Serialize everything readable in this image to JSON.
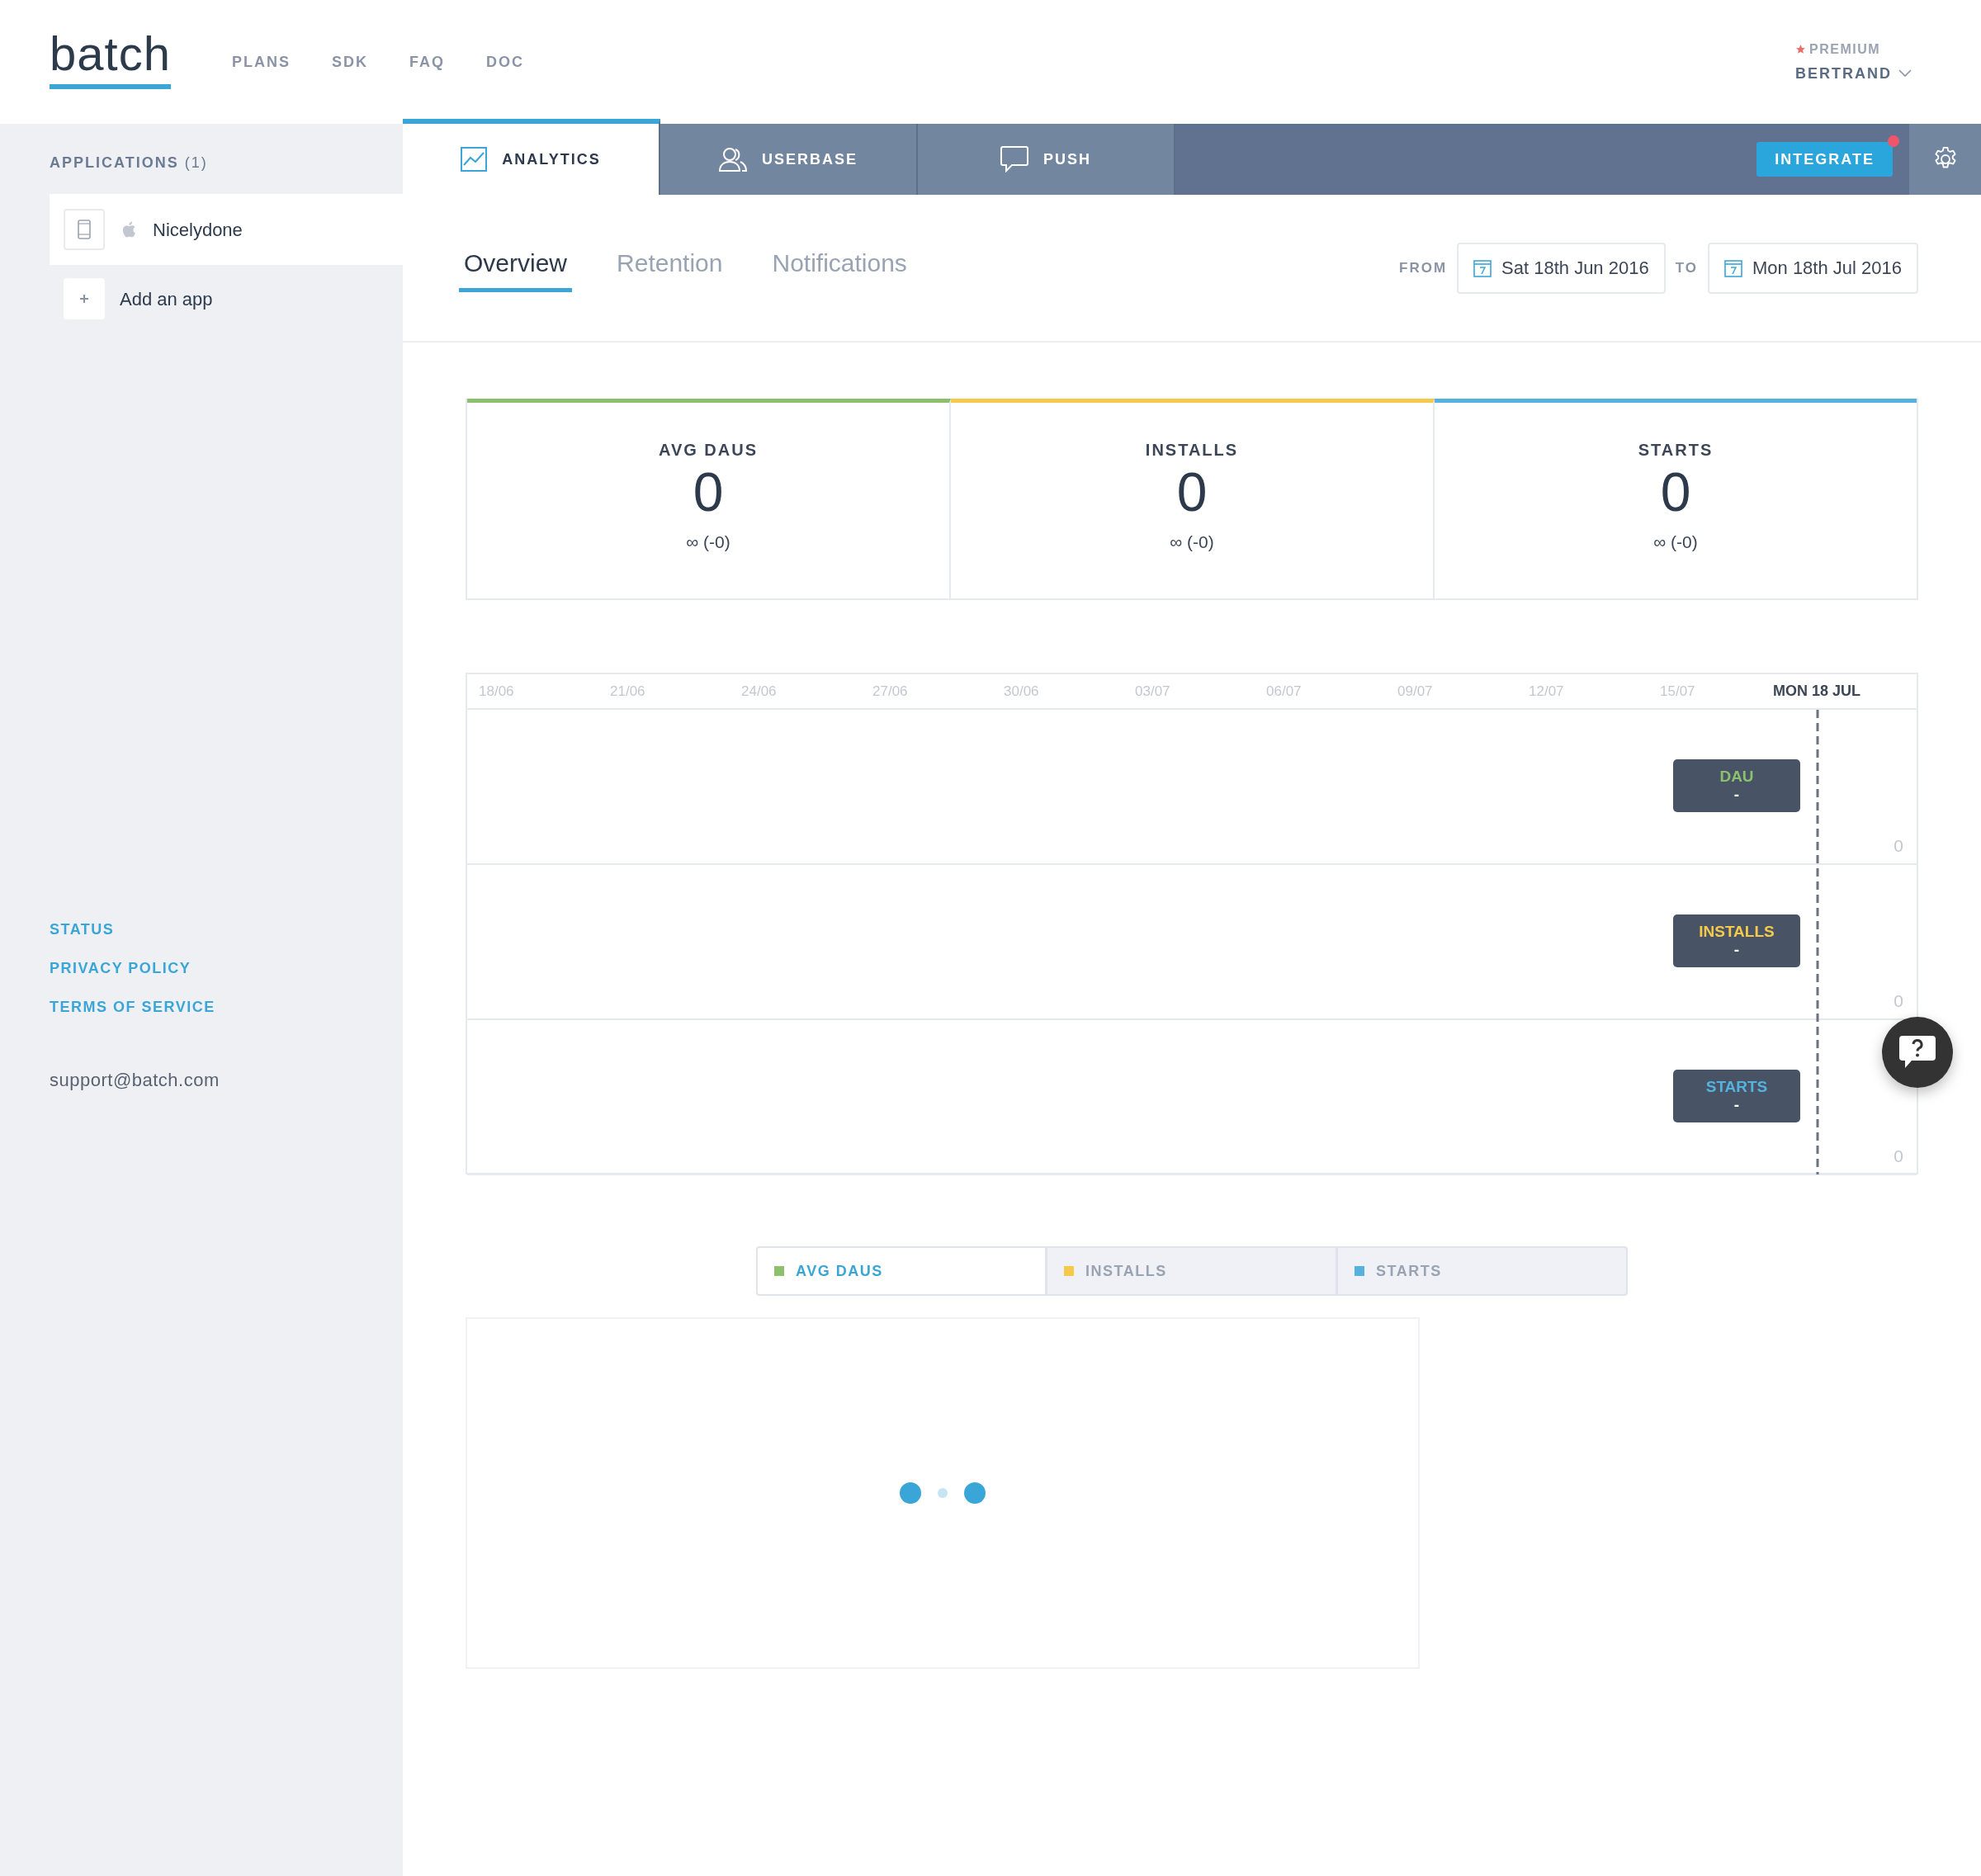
{
  "header": {
    "logo": "batch",
    "nav": [
      "PLANS",
      "SDK",
      "FAQ",
      "DOC"
    ],
    "account": {
      "plan": "PREMIUM",
      "user": "BERTRAND"
    }
  },
  "sidebar": {
    "title": "APPLICATIONS",
    "count": "(1)",
    "apps": [
      {
        "name": "Nicelydone",
        "selected": true
      }
    ],
    "add_app": "Add an app",
    "links": [
      "STATUS",
      "PRIVACY POLICY",
      "TERMS OF SERVICE"
    ],
    "email": "support@batch.com"
  },
  "main_tabs": [
    {
      "label": "ANALYTICS",
      "kind": "chart",
      "selected": true
    },
    {
      "label": "USERBASE",
      "kind": "users",
      "selected": false
    },
    {
      "label": "PUSH",
      "kind": "speech",
      "selected": false
    }
  ],
  "integrate_button": {
    "label": "INTEGRATE",
    "notification": true
  },
  "sub_tabs": [
    {
      "label": "Overview",
      "selected": true
    },
    {
      "label": "Retention",
      "selected": false
    },
    {
      "label": "Notifications",
      "selected": false
    }
  ],
  "date_range": {
    "from_label": "FROM",
    "from": "Sat 18th Jun 2016",
    "to_label": "TO",
    "to": "Mon 18th Jul 2016"
  },
  "kpis": [
    {
      "label": "AVG DAUS",
      "value": "0",
      "delta": "∞ (-0)",
      "color": "#8cc06e"
    },
    {
      "label": "INSTALLS",
      "value": "0",
      "delta": "∞ (-0)",
      "color": "#f5c94a"
    },
    {
      "label": "STARTS",
      "value": "0",
      "delta": "∞ (-0)",
      "color": "#55b1de"
    }
  ],
  "timeline": {
    "dates": [
      "18/06",
      "21/06",
      "24/06",
      "27/06",
      "30/06",
      "03/07",
      "06/07",
      "09/07",
      "12/07",
      "15/07"
    ],
    "current_date": "MON 18 JUL",
    "rows": [
      {
        "label": "DAU",
        "value": "-",
        "axis_value": "0",
        "color": "#8cc06e"
      },
      {
        "label": "INSTALLS",
        "value": "-",
        "axis_value": "0",
        "color": "#f5c94a"
      },
      {
        "label": "STARTS",
        "value": "-",
        "axis_value": "0",
        "color": "#55b1de"
      }
    ]
  },
  "legend": [
    {
      "label": "AVG DAUS",
      "selected": true,
      "color": "#8cc06e"
    },
    {
      "label": "INSTALLS",
      "selected": false,
      "color": "#f5c94a"
    },
    {
      "label": "STARTS",
      "selected": false,
      "color": "#55b1de"
    }
  ],
  "loading": true
}
